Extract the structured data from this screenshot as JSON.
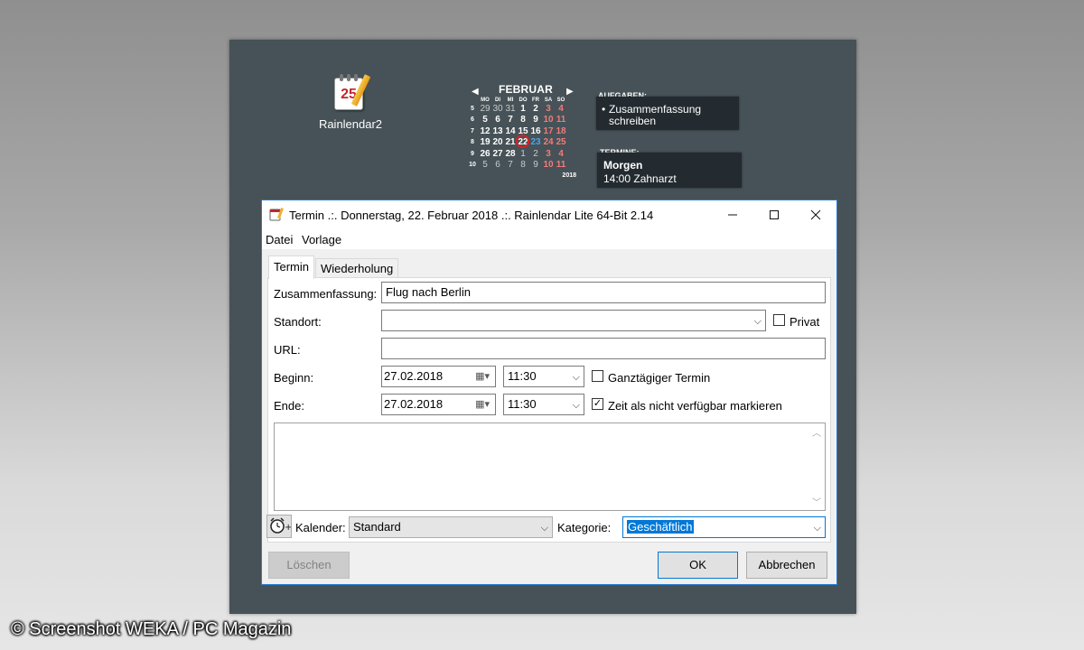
{
  "desktop": {
    "icon_label": "Rainlendar2",
    "icon_day": "25"
  },
  "calendar": {
    "month": "FEBRUAR",
    "year": "2018",
    "weekdays": [
      "MO",
      "DI",
      "MI",
      "DO",
      "FR",
      "SA",
      "SO"
    ],
    "weeks": [
      {
        "num": "5",
        "days": [
          {
            "d": "29",
            "k": "o"
          },
          {
            "d": "30",
            "k": "o"
          },
          {
            "d": "31",
            "k": "o"
          },
          {
            "d": "1",
            "k": "n"
          },
          {
            "d": "2",
            "k": "n"
          },
          {
            "d": "3",
            "k": "r"
          },
          {
            "d": "4",
            "k": "r"
          }
        ]
      },
      {
        "num": "6",
        "days": [
          {
            "d": "5",
            "k": "n"
          },
          {
            "d": "6",
            "k": "n"
          },
          {
            "d": "7",
            "k": "n"
          },
          {
            "d": "8",
            "k": "n"
          },
          {
            "d": "9",
            "k": "n"
          },
          {
            "d": "10",
            "k": "r"
          },
          {
            "d": "11",
            "k": "r"
          }
        ]
      },
      {
        "num": "7",
        "days": [
          {
            "d": "12",
            "k": "n"
          },
          {
            "d": "13",
            "k": "n"
          },
          {
            "d": "14",
            "k": "n"
          },
          {
            "d": "15",
            "k": "n"
          },
          {
            "d": "16",
            "k": "n"
          },
          {
            "d": "17",
            "k": "r"
          },
          {
            "d": "18",
            "k": "r"
          }
        ]
      },
      {
        "num": "8",
        "days": [
          {
            "d": "19",
            "k": "n"
          },
          {
            "d": "20",
            "k": "n"
          },
          {
            "d": "21",
            "k": "n"
          },
          {
            "d": "22",
            "k": "t"
          },
          {
            "d": "23",
            "k": "b"
          },
          {
            "d": "24",
            "k": "r"
          },
          {
            "d": "25",
            "k": "r"
          }
        ]
      },
      {
        "num": "9",
        "days": [
          {
            "d": "26",
            "k": "n"
          },
          {
            "d": "27",
            "k": "n"
          },
          {
            "d": "28",
            "k": "n"
          },
          {
            "d": "1",
            "k": "o"
          },
          {
            "d": "2",
            "k": "o"
          },
          {
            "d": "3",
            "k": "r"
          },
          {
            "d": "4",
            "k": "r"
          }
        ]
      },
      {
        "num": "10",
        "days": [
          {
            "d": "5",
            "k": "o"
          },
          {
            "d": "6",
            "k": "o"
          },
          {
            "d": "7",
            "k": "o"
          },
          {
            "d": "8",
            "k": "o"
          },
          {
            "d": "9",
            "k": "o"
          },
          {
            "d": "10",
            "k": "r"
          },
          {
            "d": "11",
            "k": "r"
          }
        ]
      }
    ]
  },
  "tasks": {
    "title": "AUFGABEN:",
    "item": "Zusammenfassung schreiben"
  },
  "events": {
    "title": "TERMINE:",
    "day": "Morgen",
    "item": "14:00 Zahnarzt"
  },
  "dialog": {
    "title": "Termin .:. Donnerstag, 22. Februar 2018 .:. Rainlendar Lite 64-Bit 2.14",
    "menu": [
      "Datei",
      "Vorlage"
    ],
    "tabs": [
      "Termin",
      "Wiederholung"
    ],
    "labels": {
      "summary": "Zusammenfassung:",
      "location": "Standort:",
      "url": "URL:",
      "begin": "Beginn:",
      "end": "Ende:",
      "calendar": "Kalender:",
      "category": "Kategorie:"
    },
    "values": {
      "summary": "Flug nach Berlin",
      "location": "",
      "url": "",
      "begin_date": "27.02.2018",
      "begin_time": "11:30",
      "end_date": "27.02.2018",
      "end_time": "11:30",
      "calendar": "Standard",
      "category": "Geschäftlich"
    },
    "checkboxes": {
      "private": "Privat",
      "all_day": "Ganztägiger Termin",
      "busy": "Zeit als nicht verfügbar markieren"
    },
    "buttons": {
      "delete": "Löschen",
      "ok": "OK",
      "cancel": "Abbrechen"
    }
  },
  "watermark": "© Screenshot WEKA / PC Magazin"
}
